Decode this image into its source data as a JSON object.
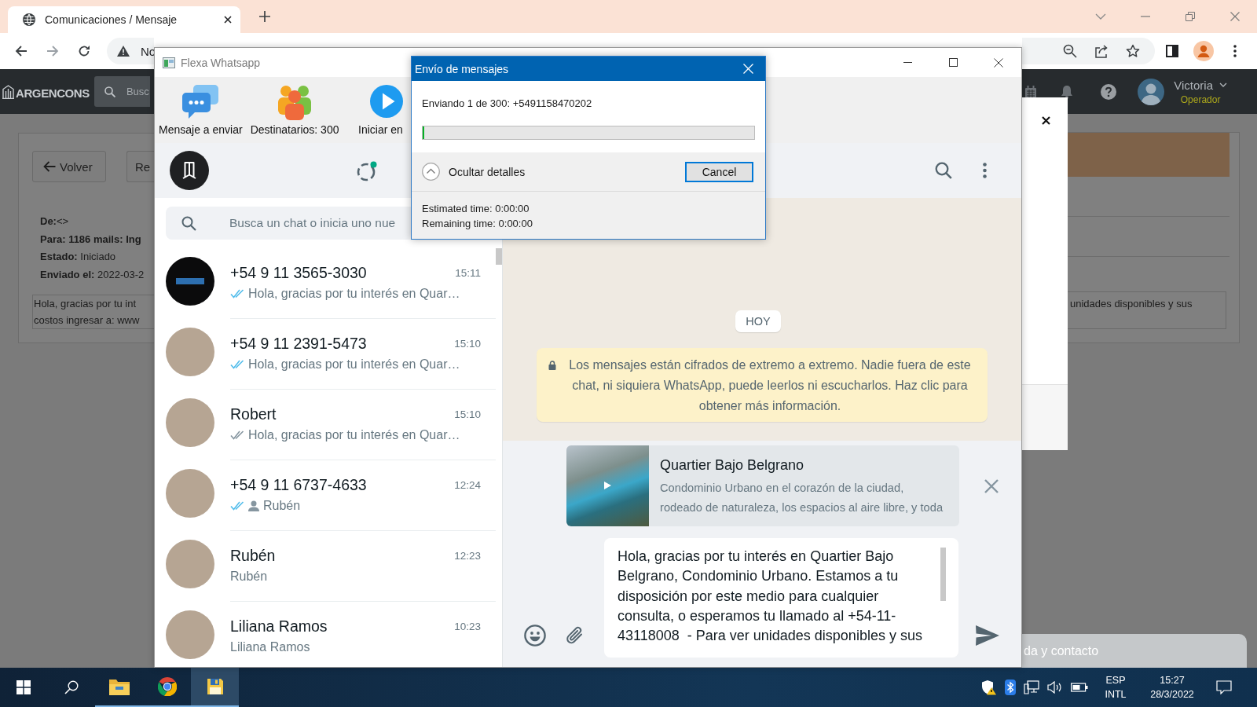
{
  "browser": {
    "tab": {
      "title": "Comunicaciones / Mensaje",
      "selected": true
    },
    "address_text": "No"
  },
  "webapp": {
    "logo": "ARGENCONS",
    "search_placeholder": "Busc",
    "user": {
      "name": "Victoria",
      "role": "Operador"
    },
    "buttons": [
      {
        "label": "Volver",
        "kind": "back"
      },
      {
        "label": "Re",
        "kind": "plain"
      }
    ],
    "fields": [
      {
        "text": "**De:**<>",
        "bold": false
      },
      {
        "text": "Para: 1186 mails: Ing",
        "bold": true
      },
      {
        "text": "**Estado:** Iniciado",
        "bold": false
      },
      {
        "text": "**Enviado el:** 2022-03-2",
        "bold": false
      }
    ],
    "message_lines": [
      "Hola, gracias por tu int",
      "costos ingresar a: www"
    ],
    "message_tail": "unidades disponibles y sus",
    "help_button": "da y contacto"
  },
  "flexa": {
    "title": "Flexa Whatsapp",
    "toolbar": [
      {
        "label": "Mensaje a enviar",
        "kind": "message"
      },
      {
        "label": "Destinatarios: 300",
        "kind": "recipients"
      },
      {
        "label": "Iniciar en",
        "kind": "start"
      }
    ],
    "search_placeholder": "Busca un chat o inicia uno nue",
    "chats": [
      {
        "kind": "logo",
        "name": "+54 9 11 3565-3030",
        "time": "15:11",
        "preview": "Hola, gracias por tu interés en Quar…",
        "delivered": true,
        "read": true,
        "sender_icon": false
      },
      {
        "kind": "photo",
        "name": "+54 9 11 2391-5473",
        "time": "15:10",
        "preview": "Hola, gracias por tu interés en Quar…",
        "delivered": true,
        "read": true,
        "sender_icon": false
      },
      {
        "kind": "photo",
        "name": "Robert",
        "time": "15:10",
        "preview": "Hola, gracias por tu interés en Quar…",
        "delivered": true,
        "read": false,
        "sender_icon": false
      },
      {
        "kind": "photo",
        "name": "+54 9 11 6737-4633",
        "time": "12:24",
        "preview": "Rubén",
        "delivered": true,
        "read": true,
        "sender_icon": true
      },
      {
        "kind": "photo",
        "name": "Rubén",
        "time": "12:23",
        "preview": "Rubén",
        "delivered": false,
        "sender_icon": false
      },
      {
        "kind": "photo",
        "name": "Liliana Ramos",
        "time": "10:23",
        "preview": "Liliana Ramos",
        "delivered": false,
        "sender_icon": false
      }
    ],
    "day_label": "HOY",
    "encryption_notice": "Los mensajes están cifrados de extremo a extremo. Nadie fuera de este chat, ni siquiera WhatsApp, puede leerlos ni escucharlos. Haz clic para obtener más información.",
    "link_preview": {
      "title": "Quartier Bajo Belgrano",
      "description": "Condominio Urbano en el corazón de la ciudad, rodeado de naturaleza, los espacios al aire libre, y toda"
    },
    "message_draft": "Hola, gracias por tu interés en Quartier Bajo Belgrano, Condominio Urbano. Estamos a tu disposición por este medio para cualquier consulta, o esperamos tu llamado al +54-11-43118008  - Para ver unidades disponibles y sus"
  },
  "dialog": {
    "title": "Envío de mensajes",
    "status": "Enviando 1 de 300: +5491158470202",
    "progress": {
      "level": 0.005
    },
    "details_toggle": "Ocultar detalles",
    "cancel": {
      "label": "Cancel",
      "focused": true
    },
    "details": [
      "Estimated time: 0:00:00",
      "Remaining time: 0:00:00"
    ]
  },
  "taskbar": {
    "apps": [
      {
        "kind": "explorer",
        "open": true,
        "selected": false
      },
      {
        "kind": "browser",
        "open": true,
        "selected": false
      },
      {
        "kind": "flexa",
        "open": true,
        "selected": true
      }
    ],
    "language": [
      "ESP",
      "INTL"
    ],
    "time": "15:27",
    "date": "28/3/2022"
  }
}
